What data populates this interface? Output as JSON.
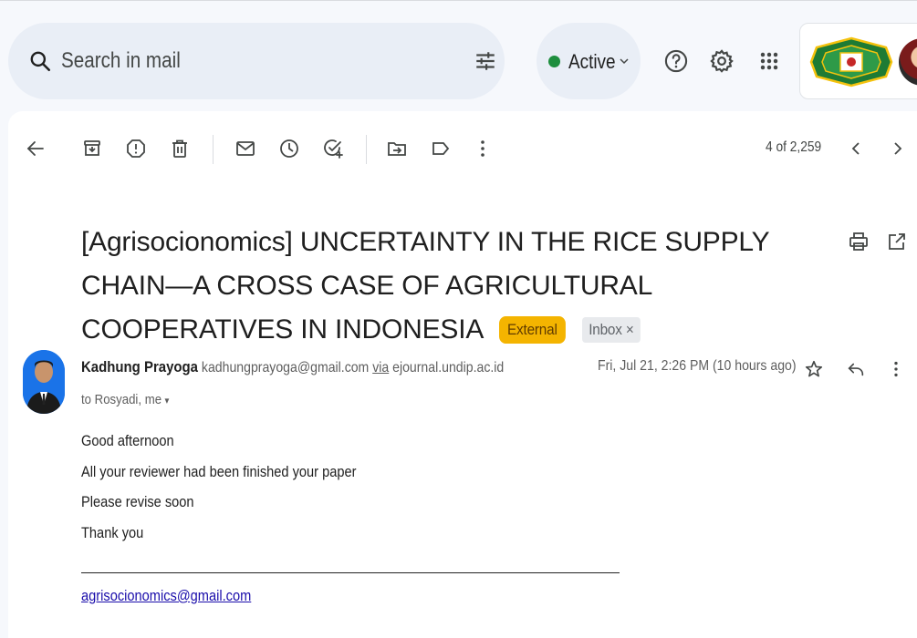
{
  "search": {
    "placeholder": "Search in mail",
    "icon": "search-icon",
    "filter_icon": "search-options-icon"
  },
  "status": {
    "label": "Active",
    "color": "#1e8e3e"
  },
  "header_icons": [
    "help-icon",
    "settings-icon",
    "apps-icon"
  ],
  "toolbar": {
    "icons": [
      "back-icon",
      "archive-icon",
      "report-spam-icon",
      "delete-icon",
      "mark-unread-icon",
      "snooze-icon",
      "add-to-tasks-icon",
      "move-to-icon",
      "label-icon",
      "more-icon"
    ],
    "pager": "4 of 2,259"
  },
  "email": {
    "subject": "[Agrisocionomics] UNCERTAINTY IN THE RICE SUPPLY CHAIN—A CROSS CASE OF AGRICULTURAL COOPERATIVES IN INDONESIA",
    "labels": {
      "external": "External",
      "inbox": "Inbox",
      "inbox_remove": "×"
    },
    "sender_name": "Kadhung Prayoga",
    "sender_email": "kadhungprayoga@gmail.com",
    "via": "via",
    "via_domain": "ejournal.undip.ac.id",
    "to": "to Rosyadi, me",
    "to_caret": "▾",
    "date": "Fri, Jul 21, 2:26 PM (10 hours ago)",
    "body": [
      "Good afternoon",
      "All your reviewer had been finished your paper",
      "Please revise soon",
      "Thank you"
    ],
    "signature_link": "agrisocionomics@gmail.com"
  },
  "colors": {
    "external_chip": "#f4b400",
    "inbox_chip": "#e8eaed",
    "link": "#1a0dab",
    "page_bg": "#f6f8fc"
  }
}
